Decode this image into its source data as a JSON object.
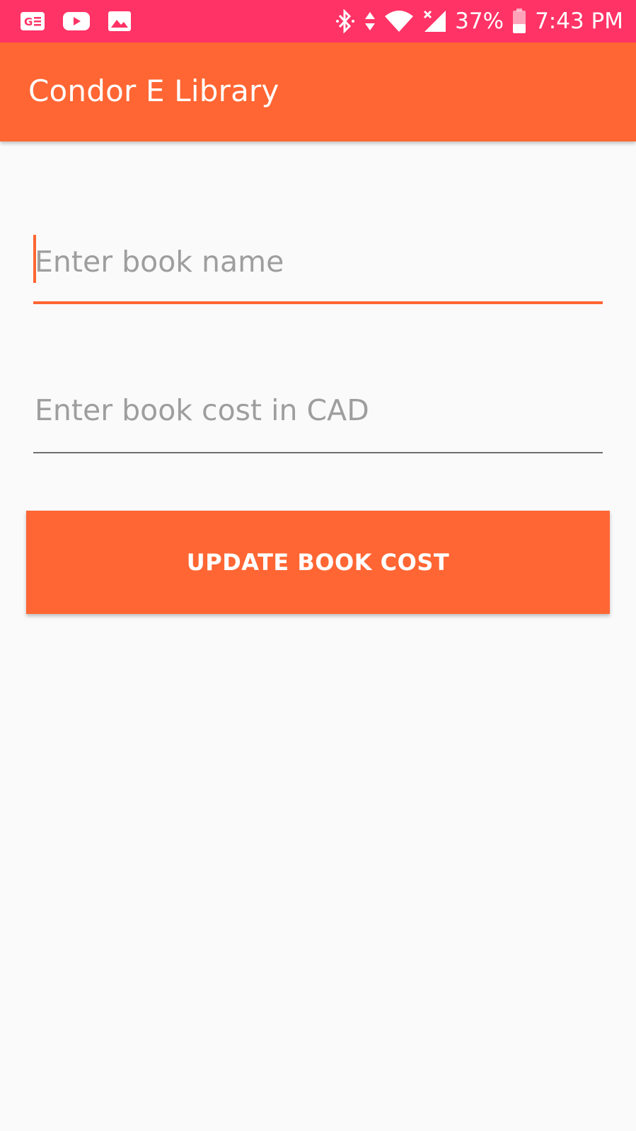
{
  "status_bar": {
    "left_icons": [
      "ge-icon",
      "youtube-icon",
      "image-icon"
    ],
    "right_icons": [
      "bluetooth-icon",
      "data-arrows-icon",
      "wifi-icon",
      "signal-icon",
      "battery-icon"
    ],
    "battery_percent": "37%",
    "time": "7:43 PM",
    "background_color": "#ff3366"
  },
  "app_bar": {
    "title": "Condor E Library",
    "background_color": "#ff6633"
  },
  "form": {
    "book_name": {
      "value": "",
      "placeholder": "Enter book name"
    },
    "book_cost": {
      "value": "",
      "placeholder": "Enter book cost in CAD"
    },
    "update_button_label": "UPDATE BOOK COST"
  },
  "colors": {
    "accent": "#ff6633",
    "placeholder": "#9e9e9e",
    "background": "#fafafa"
  }
}
